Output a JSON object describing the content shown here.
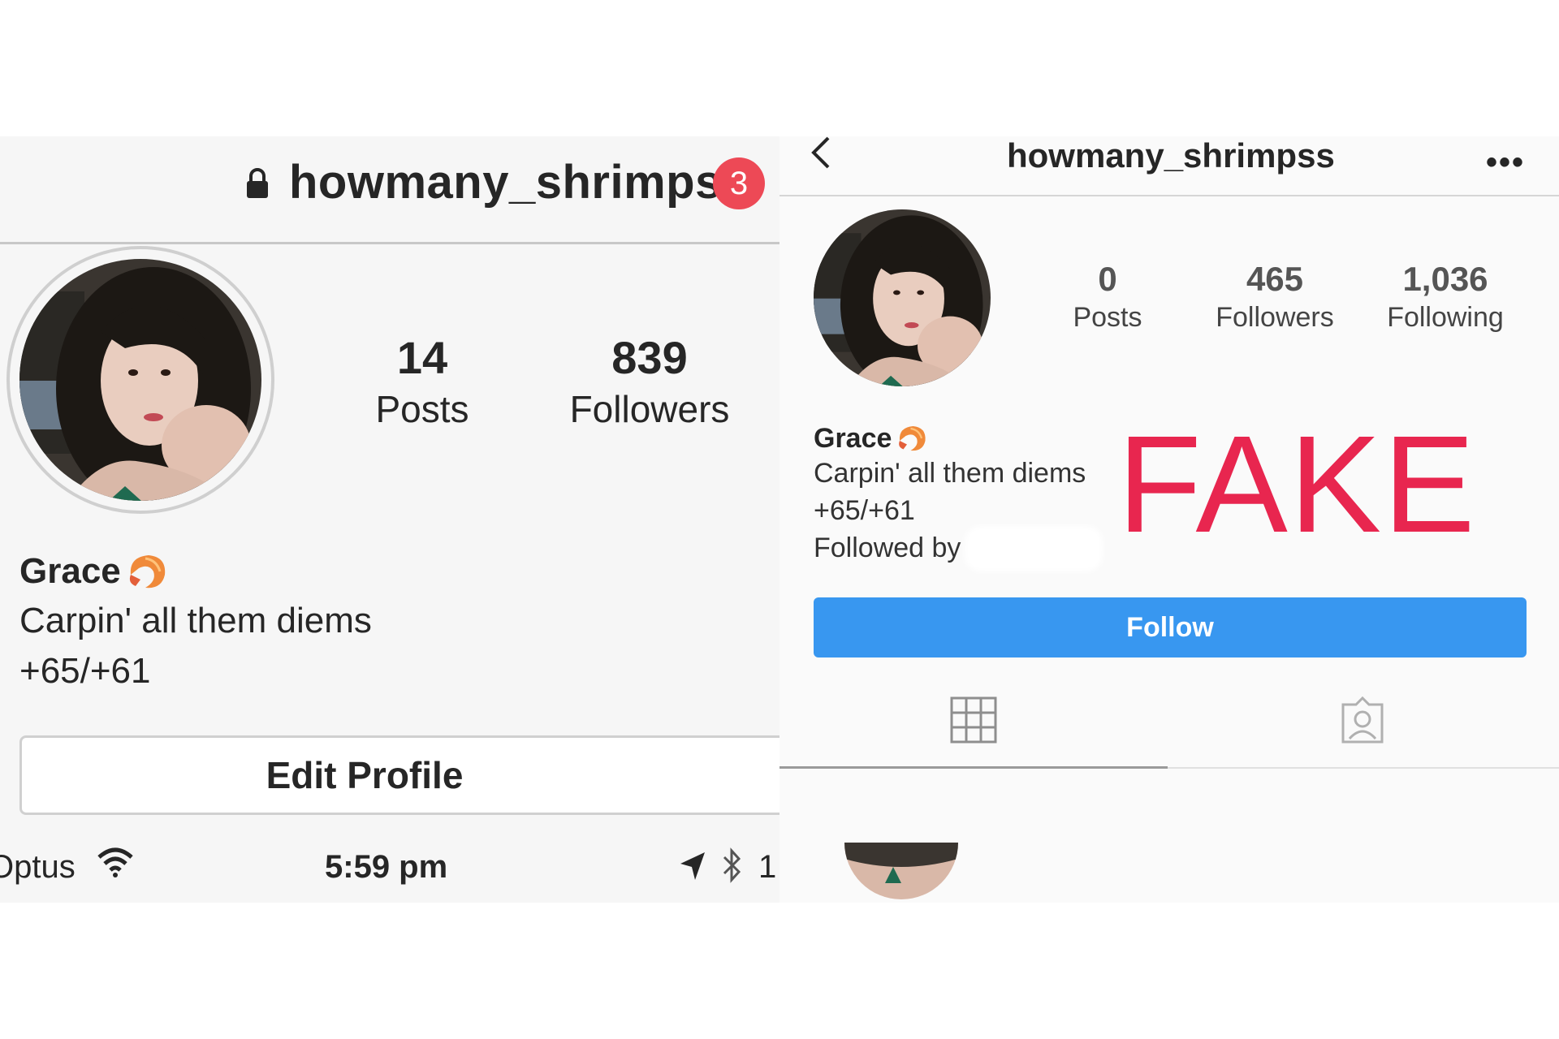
{
  "left_profile": {
    "username": "howmany_shrimps",
    "notification_count": "3",
    "stats": [
      {
        "value": "14",
        "label": "Posts"
      },
      {
        "value": "839",
        "label": "Followers"
      }
    ],
    "name": "Grace",
    "bio_line1": "Carpin' all them diems",
    "bio_line2": "+65/+61",
    "edit_button": "Edit Profile",
    "status_bar": {
      "carrier": "Optus",
      "time": "5:59 pm",
      "battery": "1"
    }
  },
  "right_profile": {
    "username": "howmany_shrimpss",
    "more": "•••",
    "stats": [
      {
        "value": "0",
        "label": "Posts"
      },
      {
        "value": "465",
        "label": "Followers"
      },
      {
        "value": "1,036",
        "label": "Following"
      }
    ],
    "name": "Grace",
    "bio_line1": "Carpin' all them diems",
    "bio_line2": "+65/+61",
    "followed_by": "Followed by ",
    "follow_button": "Follow"
  },
  "overlay_label": "FAKE",
  "colors": {
    "follow_blue": "#3897f0",
    "badge_red": "#ed4956",
    "fake_red": "#e8264f"
  }
}
